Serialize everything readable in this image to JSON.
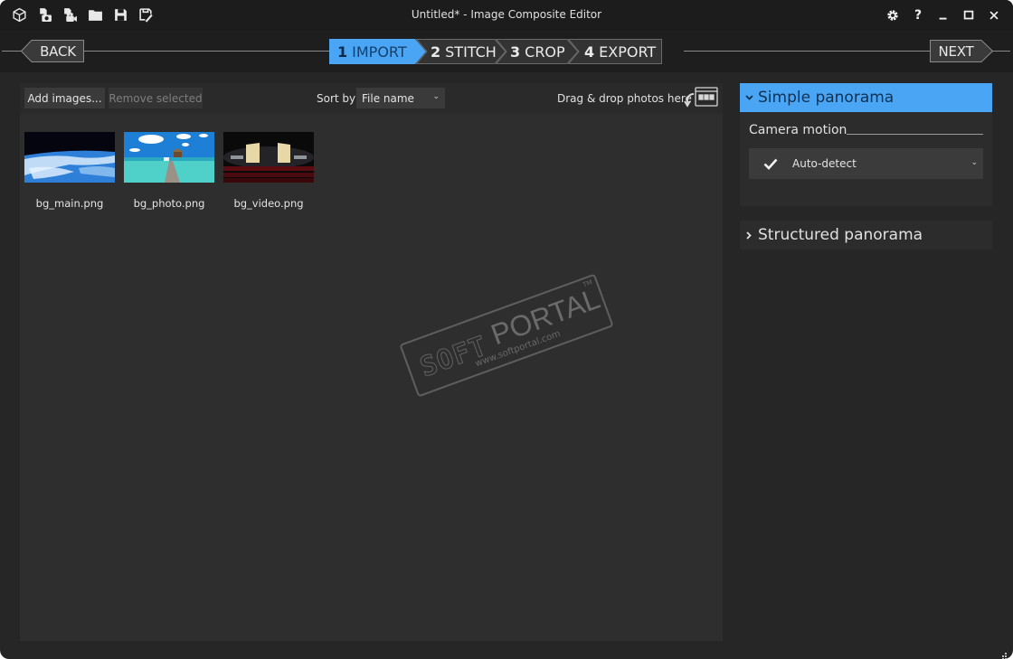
{
  "titlebar": {
    "title": "Untitled* - Image Composite Editor",
    "quick_icons": [
      "app-cube-icon",
      "new-panorama-from-images-icon",
      "new-panorama-from-video-icon",
      "open-folder-icon",
      "save-icon",
      "save-as-icon"
    ],
    "window_controls": [
      "settings-gear-icon",
      "help-icon",
      "minimize-icon",
      "maximize-icon",
      "close-icon"
    ],
    "help_glyph": "?"
  },
  "wizard": {
    "back_label": "BACK",
    "next_label": "NEXT",
    "steps": [
      {
        "num": "1",
        "label": "IMPORT",
        "active": true
      },
      {
        "num": "2",
        "label": "STITCH",
        "active": false
      },
      {
        "num": "3",
        "label": "CROP",
        "active": false
      },
      {
        "num": "4",
        "label": "EXPORT",
        "active": false
      }
    ]
  },
  "toolbar": {
    "add_images_label": "Add images...",
    "remove_selected_label": "Remove selected",
    "remove_selected_enabled": false,
    "sort_label": "Sort by",
    "sort_value": "File name",
    "drop_hint": "Drag & drop photos here"
  },
  "images": [
    {
      "name": "bg_main.png"
    },
    {
      "name": "bg_photo.png"
    },
    {
      "name": "bg_video.png"
    }
  ],
  "watermark": {
    "soft": "SOFT",
    "portal": "PORTAL",
    "url": "www.softportal.com",
    "tm": "TM"
  },
  "side_panel": {
    "simple": {
      "title": "Simple panorama",
      "expanded": true,
      "camera_motion_label": "Camera motion",
      "camera_motion_value": "Auto-detect"
    },
    "structured": {
      "title": "Structured panorama",
      "expanded": false
    }
  },
  "colors": {
    "accent": "#4aa5f4",
    "background": "#262626",
    "panel": "#2e2e2e",
    "titlebar": "#1c1c1c"
  }
}
